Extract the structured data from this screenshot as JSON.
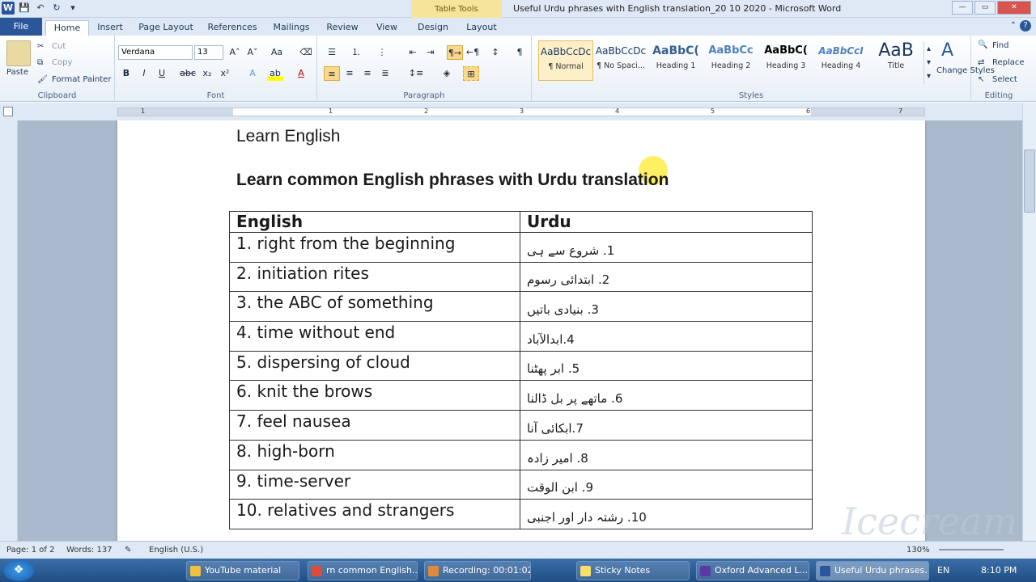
{
  "window": {
    "title": "Useful Urdu phrases with English translation_20 10 2020  -  Microsoft Word",
    "context_tab": "Table Tools",
    "min": "—",
    "max": "▭",
    "close": "✕"
  },
  "tabs": [
    "File",
    "Home",
    "Insert",
    "Page Layout",
    "References",
    "Mailings",
    "Review",
    "View",
    "Design",
    "Layout"
  ],
  "clipboard": {
    "paste": "Paste",
    "cut": "Cut",
    "copy": "Copy",
    "format_painter": "Format Painter",
    "label": "Clipboard"
  },
  "font": {
    "family": "Verdana",
    "size": "13",
    "label": "Font"
  },
  "paragraph": {
    "label": "Paragraph"
  },
  "styles": {
    "items": [
      {
        "preview": "AaBbCcDc",
        "name": "¶ Normal"
      },
      {
        "preview": "AaBbCcDc",
        "name": "¶ No Spaci..."
      },
      {
        "preview": "AaBbC(",
        "name": "Heading 1"
      },
      {
        "preview": "AaBbCc",
        "name": "Heading 2"
      },
      {
        "preview": "AaBbC(",
        "name": "Heading 3"
      },
      {
        "preview": "AaBbCcI",
        "name": "Heading 4"
      },
      {
        "preview": "AaB",
        "name": "Title"
      }
    ],
    "change_styles": "Change Styles",
    "label": "Styles"
  },
  "editing": {
    "find": "Find",
    "replace": "Replace",
    "select": "Select",
    "label": "Editing"
  },
  "ruler_numbers": [
    "1",
    "1",
    "2",
    "3",
    "4",
    "5",
    "6",
    "7"
  ],
  "document": {
    "heading": "Learn English",
    "subheading": "Learn common English phrases with Urdu translation",
    "table_headers": [
      "English",
      "Urdu"
    ],
    "rows": [
      {
        "en": "1. right from the beginning",
        "ur": "1. شروع سے ہی"
      },
      {
        "en": "2. initiation rites",
        "ur": "2. ابتدائی رسوم"
      },
      {
        "en": "3. the ABC of something",
        "ur": "3. بنیادی باتیں"
      },
      {
        "en": "4. time without end",
        "ur": "4.ابدالآباد"
      },
      {
        "en": "5. dispersing of cloud",
        "ur": "5. ابر پھٹنا"
      },
      {
        "en": "6. knit the brows",
        "ur": "6. ماتھے پر بل ڈالنا"
      },
      {
        "en": "7. feel nausea",
        "ur": "7.ابکائی آنا"
      },
      {
        "en": "8. high-born",
        "ur": "8. امیر زادہ"
      },
      {
        "en": "9. time-server",
        "ur": "9. ابن الوقت"
      },
      {
        "en": "10. relatives and strangers",
        "ur": "10. رشتہ دار اور اجنبی"
      }
    ]
  },
  "status": {
    "page": "Page: 1 of 2",
    "words": "Words: 137",
    "language": "English (U.S.)",
    "zoom": "130%"
  },
  "watermark": "Icecream",
  "taskbar": {
    "items": [
      "YouTube material",
      "rn common English...",
      "Recording:  00:01:02",
      "Sticky Notes",
      "Oxford Advanced L...",
      "Useful Urdu phrases..."
    ],
    "lang": "EN",
    "time": "8:10 PM"
  }
}
